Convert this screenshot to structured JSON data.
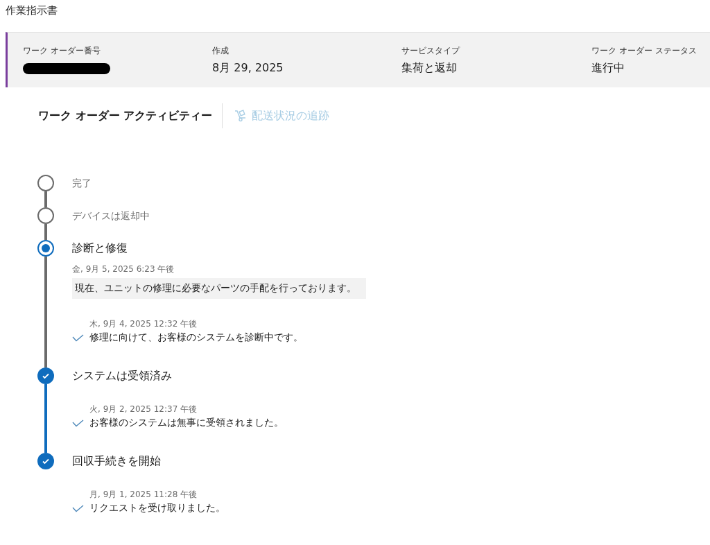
{
  "page_title": "作業指示書",
  "summary": [
    {
      "label": "ワーク オーダー番号",
      "redacted": true
    },
    {
      "label": "作成",
      "value": "8月 29, 2025"
    },
    {
      "label": "サービスタイプ",
      "value": "集荷と返却"
    },
    {
      "label": "ワーク オーダー ステータス",
      "value": "進行中"
    }
  ],
  "tabs": [
    {
      "label": "ワーク オーダー アクティビティー",
      "selected": true,
      "disabled": false
    },
    {
      "label": "配送状況の追跡",
      "selected": false,
      "disabled": true
    }
  ],
  "steps": [
    {
      "title": "完了",
      "completed": false,
      "current": false
    },
    {
      "title": "デバイスは返却中",
      "completed": false,
      "current": false
    },
    {
      "title": "診断と修復",
      "completed": false,
      "current": true,
      "entries": [
        {
          "kind": "note",
          "date": "金, 9月 5, 2025 6:23 午後",
          "text": "現在、ユニットの修理に必要なパーツの手配を行っております。"
        },
        {
          "kind": "update",
          "date": "木, 9月 4, 2025 12:32 午後",
          "text": "修理に向けて、お客様のシステムを診断中です。"
        }
      ]
    },
    {
      "title": "システムは受領済み",
      "completed": true,
      "current": false,
      "entries": [
        {
          "kind": "update",
          "date": "火, 9月 2, 2025 12:37 午後",
          "text": "お客様のシステムは無事に受領されました。"
        }
      ]
    },
    {
      "title": "回収手続きを開始",
      "completed": true,
      "current": false,
      "entries": [
        {
          "kind": "update",
          "date": "月, 9月 1, 2025 11:28 午後",
          "text": "リクエストを受け取りました。"
        }
      ]
    }
  ]
}
